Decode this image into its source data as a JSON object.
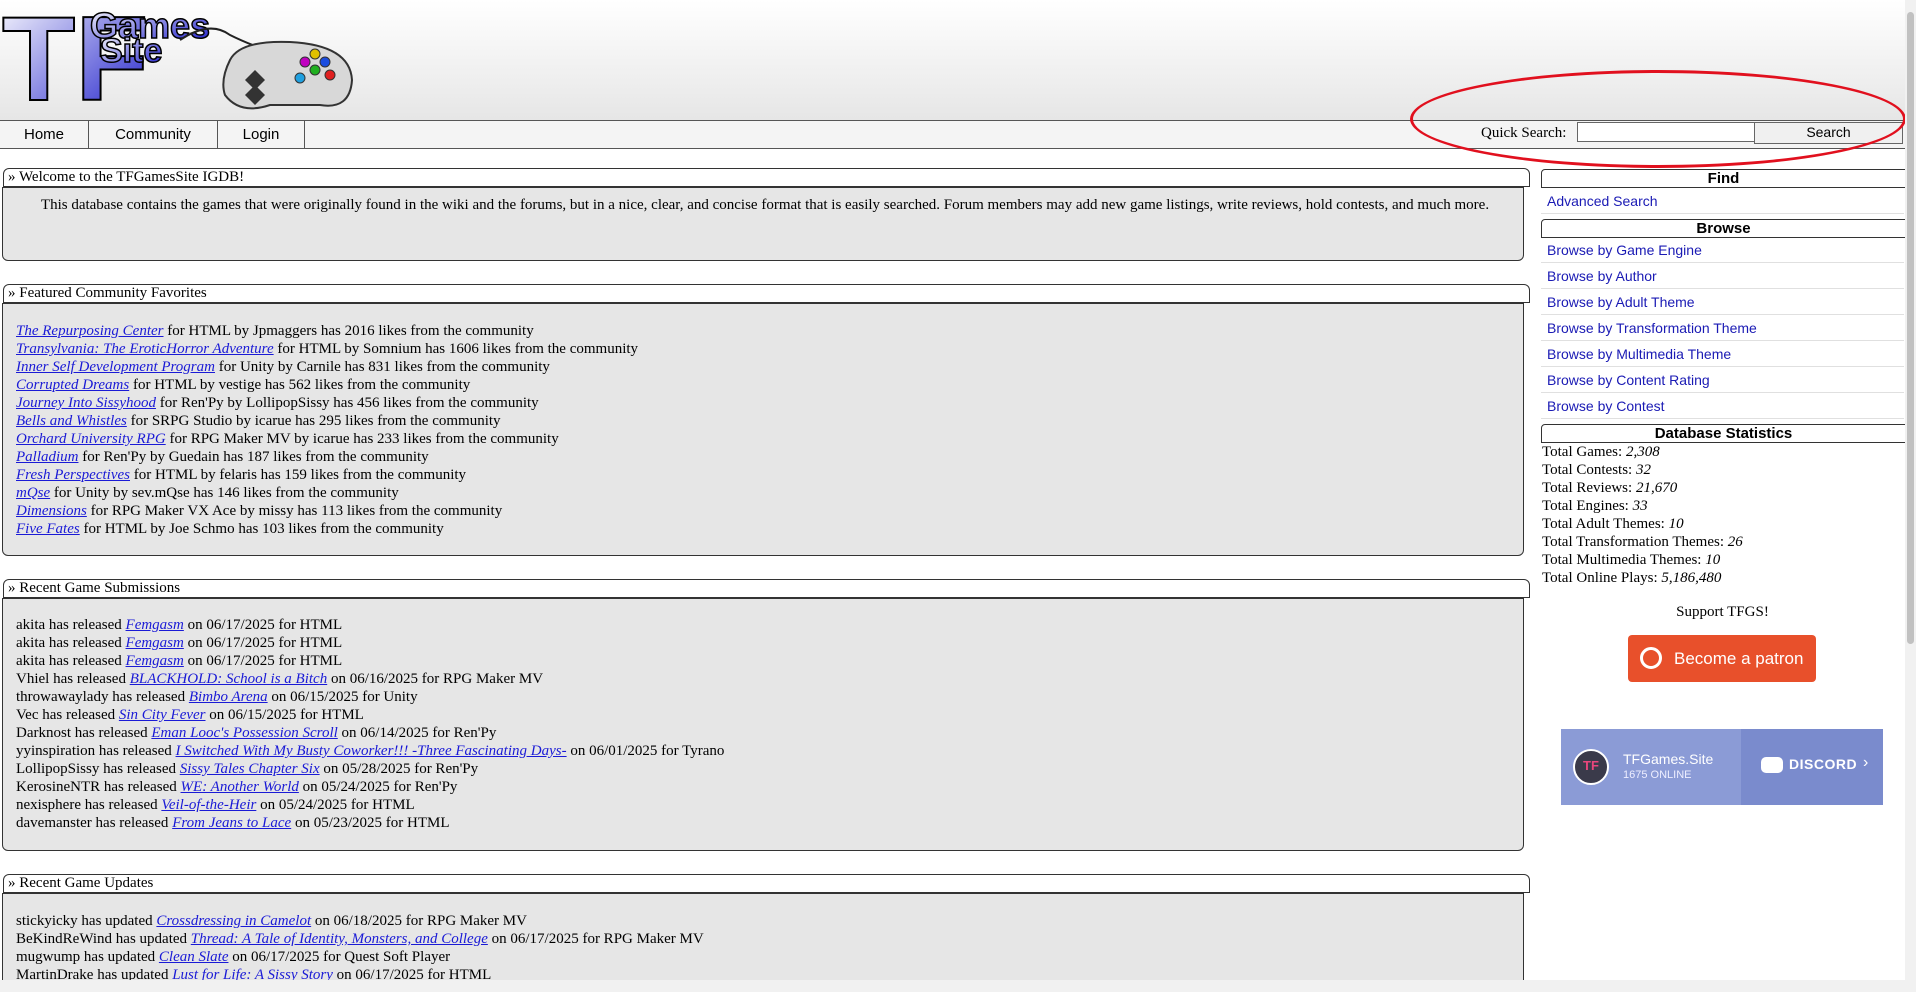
{
  "logo": {
    "text_tf": "TF",
    "text_games": "Games",
    "text_site": "Site"
  },
  "nav": {
    "home": "Home",
    "community": "Community",
    "login": "Login"
  },
  "quick_search": {
    "label": "Quick Search:",
    "value": "",
    "button": "Search"
  },
  "welcome": {
    "title": "» Welcome to the TFGamesSite IGDB!",
    "text": "This database contains the games that were originally found in the wiki and the forums, but in a nice, clear, and concise format that is easily searched. Forum members may add new game listings, write reviews, hold contests, and much more."
  },
  "featured": {
    "title": "» Featured Community Favorites",
    "items": [
      {
        "game": "The Repurposing Center",
        "rest": " for HTML by Jpmaggers has 2016 likes from the community"
      },
      {
        "game": "Transylvania: The EroticHorror Adventure",
        "rest": " for HTML by Somnium has 1606 likes from the community"
      },
      {
        "game": "Inner Self Development Program",
        "rest": " for Unity by Carnile has 831 likes from the community"
      },
      {
        "game": "Corrupted Dreams",
        "rest": " for HTML by vestige has 562 likes from the community"
      },
      {
        "game": "Journey Into Sissyhood",
        "rest": " for Ren'Py by LollipopSissy has 456 likes from the community"
      },
      {
        "game": "Bells and Whistles",
        "rest": " for SRPG Studio by icarue has 295 likes from the community"
      },
      {
        "game": "Orchard University RPG",
        "rest": " for RPG Maker MV by icarue has 233 likes from the community"
      },
      {
        "game": "Palladium",
        "rest": " for Ren'Py by Guedain has 187 likes from the community"
      },
      {
        "game": "Fresh Perspectives",
        "rest": " for HTML by felaris has 159 likes from the community"
      },
      {
        "game": "mQse",
        "rest": " for Unity by sev.mQse has 146 likes from the community"
      },
      {
        "game": "Dimensions",
        "rest": " for RPG Maker VX Ace by missy has 113 likes from the community"
      },
      {
        "game": "Five Fates",
        "rest": " for HTML by Joe Schmo has 103 likes from the community"
      }
    ]
  },
  "submissions": {
    "title": "» Recent Game Submissions",
    "items": [
      {
        "pre": "akita has released ",
        "game": "Femgasm",
        "post": " on 06/17/2025 for HTML"
      },
      {
        "pre": "akita has released ",
        "game": "Femgasm",
        "post": " on 06/17/2025 for HTML"
      },
      {
        "pre": "akita has released ",
        "game": "Femgasm",
        "post": " on 06/17/2025 for HTML"
      },
      {
        "pre": "Vhiel has released ",
        "game": "BLACKHOLD: School is a Bitch",
        "post": " on 06/16/2025 for RPG Maker MV"
      },
      {
        "pre": "throwawaylady has released ",
        "game": "Bimbo Arena",
        "post": " on 06/15/2025 for Unity"
      },
      {
        "pre": "Vec has released ",
        "game": "Sin City Fever",
        "post": " on 06/15/2025 for HTML"
      },
      {
        "pre": "Darknost has released ",
        "game": "Eman Looc's Possession Scroll",
        "post": " on 06/14/2025 for Ren'Py"
      },
      {
        "pre": "yyinspiration has released ",
        "game": "I Switched With My Busty Coworker!!! -Three Fascinating Days-",
        "post": " on 06/01/2025 for Tyrano"
      },
      {
        "pre": "LollipopSissy has released ",
        "game": "Sissy Tales Chapter Six",
        "post": " on 05/28/2025 for Ren'Py"
      },
      {
        "pre": "KerosineNTR has released ",
        "game": "WE: Another World",
        "post": " on 05/24/2025 for Ren'Py"
      },
      {
        "pre": "nexisphere has released ",
        "game": "Veil-of-the-Heir",
        "post": " on 05/24/2025 for HTML"
      },
      {
        "pre": "davemanster has released ",
        "game": "From Jeans to Lace",
        "post": " on 05/23/2025 for HTML"
      }
    ]
  },
  "updates": {
    "title": "» Recent Game Updates",
    "items": [
      {
        "pre": "stickyicky has updated ",
        "game": "Crossdressing in Camelot",
        "post": " on 06/18/2025 for RPG Maker MV"
      },
      {
        "pre": "BeKindReWind has updated ",
        "game": "Thread: A Tale of Identity, Monsters, and College",
        "post": " on 06/17/2025 for RPG Maker MV"
      },
      {
        "pre": "mugwump has updated ",
        "game": "Clean Slate",
        "post": " on 06/17/2025 for Quest Soft Player"
      },
      {
        "pre": "MartinDrake has updated ",
        "game": "Lust for Life: A Sissy Story",
        "post": " on 06/17/2025 for HTML"
      }
    ]
  },
  "sidebar": {
    "find": "Find",
    "advanced_search": "Advanced Search",
    "browse": "Browse",
    "browse_links": [
      "Browse by Game Engine",
      "Browse by Author",
      "Browse by Adult Theme",
      "Browse by Transformation Theme",
      "Browse by Multimedia Theme",
      "Browse by Content Rating",
      "Browse by Contest"
    ],
    "stats_title": "Database Statistics",
    "stats": [
      {
        "label": "Total Games: ",
        "value": "2,308"
      },
      {
        "label": "Total Contests: ",
        "value": "32"
      },
      {
        "label": "Total Reviews: ",
        "value": "21,670"
      },
      {
        "label": "Total Engines: ",
        "value": "33"
      },
      {
        "label": "Total Adult Themes: ",
        "value": "10"
      },
      {
        "label": "Total Transformation Themes: ",
        "value": "26"
      },
      {
        "label": "Total Multimedia Themes: ",
        "value": "10"
      },
      {
        "label": "Total Online Plays: ",
        "value": "5,186,480"
      }
    ],
    "support": "Support TFGS!",
    "patron_button": "Become a patron",
    "discord": {
      "server": "TFGames.Site",
      "online": "1675 ONLINE",
      "brand": "DISCORD",
      "badge": "TF"
    }
  }
}
